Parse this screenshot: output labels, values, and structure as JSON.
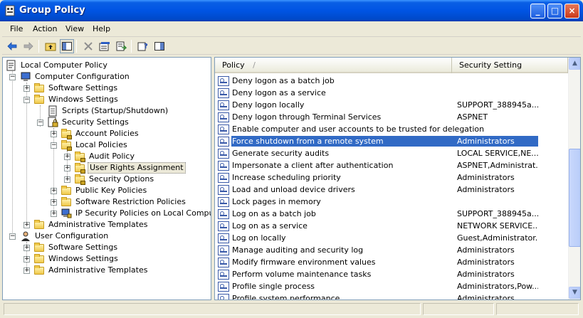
{
  "window": {
    "title": "Group Policy",
    "minimize": "_",
    "maximize": "□",
    "close": "×"
  },
  "menu": [
    "File",
    "Action",
    "View",
    "Help"
  ],
  "tree": {
    "root": "Local Computer Policy",
    "computer_config": "Computer Configuration",
    "cc_software": "Software Settings",
    "cc_windows": "Windows Settings",
    "scripts": "Scripts (Startup/Shutdown)",
    "security_settings": "Security Settings",
    "account_policies": "Account Policies",
    "local_policies": "Local Policies",
    "audit_policy": "Audit Policy",
    "user_rights": "User Rights Assignment",
    "security_options": "Security Options",
    "public_key": "Public Key Policies",
    "software_restriction": "Software Restriction Policies",
    "ipsec": "IP Security Policies on Local Computer",
    "cc_admin_templates": "Administrative Templates",
    "user_config": "User Configuration",
    "uc_software": "Software Settings",
    "uc_windows": "Windows Settings",
    "uc_admin_templates": "Administrative Templates"
  },
  "list": {
    "col_policy": "Policy",
    "col_policy_sort": "/",
    "col_setting": "Security Setting",
    "rows": [
      {
        "name": "Deny logon as a batch job",
        "setting": ""
      },
      {
        "name": "Deny logon as a service",
        "setting": ""
      },
      {
        "name": "Deny logon locally",
        "setting": "SUPPORT_388945a..."
      },
      {
        "name": "Deny logon through Terminal Services",
        "setting": "ASPNET"
      },
      {
        "name": "Enable computer and user accounts to be trusted for delegation",
        "setting": ""
      },
      {
        "name": "Force shutdown from a remote system",
        "setting": "Administrators"
      },
      {
        "name": "Generate security audits",
        "setting": "LOCAL SERVICE,NE..."
      },
      {
        "name": "Impersonate a client after authentication",
        "setting": "ASPNET,Administrat..."
      },
      {
        "name": "Increase scheduling priority",
        "setting": "Administrators"
      },
      {
        "name": "Load and unload device drivers",
        "setting": "Administrators"
      },
      {
        "name": "Lock pages in memory",
        "setting": ""
      },
      {
        "name": "Log on as a batch job",
        "setting": "SUPPORT_388945a..."
      },
      {
        "name": "Log on as a service",
        "setting": "NETWORK SERVICE..."
      },
      {
        "name": "Log on locally",
        "setting": "Guest,Administrator..."
      },
      {
        "name": "Manage auditing and security log",
        "setting": "Administrators"
      },
      {
        "name": "Modify firmware environment values",
        "setting": "Administrators"
      },
      {
        "name": "Perform volume maintenance tasks",
        "setting": "Administrators"
      },
      {
        "name": "Profile single process",
        "setting": "Administrators,Pow..."
      },
      {
        "name": "Profile system performance",
        "setting": "Administrators"
      }
    ],
    "selected_index": 5
  },
  "scrollbar": {
    "up": "▲",
    "down": "▼"
  }
}
